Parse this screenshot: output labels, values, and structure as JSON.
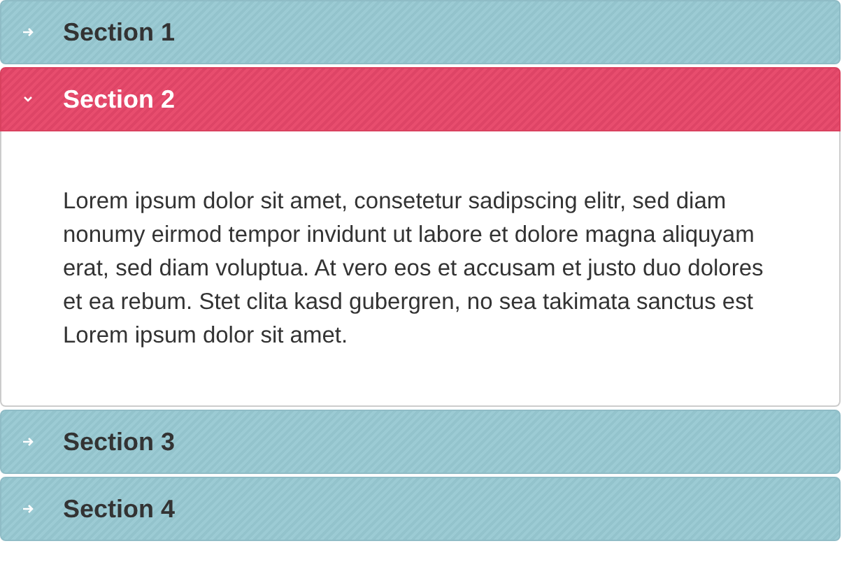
{
  "sections": [
    {
      "title": "Section 1",
      "expanded": false
    },
    {
      "title": "Section 2",
      "expanded": true,
      "body": "Lorem ipsum dolor sit amet, consetetur sadipscing elitr, sed diam nonumy eirmod tempor invidunt ut labore et dolore magna aliquyam erat, sed diam voluptua. At vero eos et accusam et justo duo dolores et ea rebum. Stet clita kasd gubergren, no sea takimata sanctus est Lorem ipsum dolor sit amet."
    },
    {
      "title": "Section 3",
      "expanded": false
    },
    {
      "title": "Section 4",
      "expanded": false
    }
  ]
}
